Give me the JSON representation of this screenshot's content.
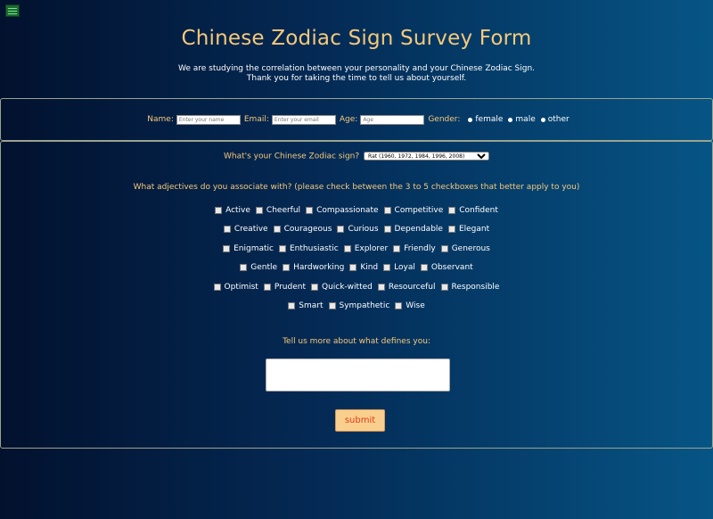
{
  "menu": {
    "icon": "hamburger-menu-icon"
  },
  "header": {
    "title": "Chinese Zodiac Sign Survey Form",
    "intro_line1": "We are studying the correlation between your personality and your Chinese Zodiac Sign.",
    "intro_line2": "Thank you for taking the time to tell us about yourself."
  },
  "personal": {
    "name_label": "Name:",
    "name_placeholder": "Enter your name",
    "email_label": "Email:",
    "email_placeholder": "Enter your email",
    "age_label": "Age:",
    "age_placeholder": "Age",
    "gender_label": "Gender:",
    "gender_options": [
      "female",
      "male",
      "other"
    ]
  },
  "zodiac": {
    "question": "What's your Chinese Zodiac sign?",
    "selected": "Rat (1960, 1972, 1984, 1996, 2008)"
  },
  "adjectives": {
    "question": "What adjectives do you associate with? (please check between the 3 to 5 checkboxes that better apply to you)",
    "rows": [
      [
        "Active",
        "Cheerful",
        "Compassionate",
        "Competitive",
        "Confident"
      ],
      [
        "Creative",
        "Courageous",
        "Curious",
        "Dependable",
        "Elegant"
      ],
      [
        "Enigmatic",
        "Enthusiastic",
        "Explorer",
        "Friendly",
        "Generous"
      ],
      [
        "Gentle",
        "Hardworking",
        "Kind",
        "Loyal",
        "Observant"
      ],
      [
        "Optimist",
        "Prudent",
        "Quick-witted",
        "Resourceful",
        "Responsible"
      ],
      [
        "Smart",
        "Sympathetic",
        "Wise"
      ]
    ]
  },
  "more": {
    "question": "Tell us more about what defines you:"
  },
  "submit_label": "submit",
  "colors": {
    "accent": "#f6c97a",
    "button_bg": "#f9cf8e",
    "button_text": "#e33b1a"
  }
}
